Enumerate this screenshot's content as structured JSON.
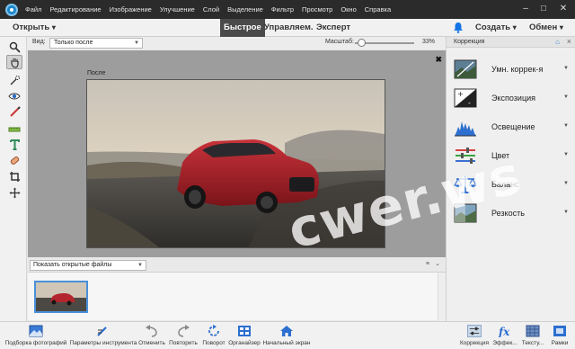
{
  "menubar": {
    "items": [
      "Файл",
      "Редактирование",
      "Изображение",
      "Улучшение",
      "Слой",
      "Выделение",
      "Фильтр",
      "Просмотр",
      "Окно",
      "Справка"
    ],
    "minimize": "–",
    "restore": "□",
    "close": "✕"
  },
  "modebar": {
    "open_label": "Открыть",
    "tabs": [
      "Быстрое",
      "Управляем.",
      "Эксперт"
    ],
    "active_tab": "Быстрое",
    "create_label": "Создать",
    "share_label": "Обмен",
    "chevron": "▾"
  },
  "options": {
    "view_label": "Вид:",
    "view_value": "Только после",
    "zoom_label": "Масштаб:",
    "zoom_value": "33%",
    "zoom_fraction": 0.06
  },
  "canvas": {
    "after_label": "После",
    "close_label": "✖"
  },
  "photo_bin": {
    "select_value": "Показать открытые файлы",
    "menu_icon": "≡",
    "collapse_icon": "⌄"
  },
  "right_panel": {
    "title": "Коррекция",
    "help_icon": "⌂",
    "close_icon": "×",
    "adjustments": [
      {
        "label": "Умн. коррек-я",
        "icon": "smart-fix-icon"
      },
      {
        "label": "Экспозиция",
        "icon": "exposure-icon"
      },
      {
        "label": "Освещение",
        "icon": "lighting-icon"
      },
      {
        "label": "Цвет",
        "icon": "color-icon"
      },
      {
        "label": "Баланс",
        "icon": "balance-icon"
      },
      {
        "label": "Резкость",
        "icon": "sharpen-icon"
      }
    ],
    "chevron": "▼"
  },
  "bottombar": {
    "buttons": [
      {
        "label": "Подборка фотографий",
        "icon": "photo-bin-icon"
      },
      {
        "label": "Параметры инструмента",
        "icon": "tool-options-icon"
      },
      {
        "label": "Отменить",
        "icon": "undo-icon"
      },
      {
        "label": "Повторить",
        "icon": "redo-icon"
      },
      {
        "label": "Поворот",
        "icon": "rotate-icon"
      },
      {
        "label": "Органайзер",
        "icon": "organizer-icon"
      },
      {
        "label": "Начальный экран",
        "icon": "home-icon"
      },
      {
        "label": "Коррекция",
        "icon": "adjustments-icon"
      },
      {
        "label": "Эффек...",
        "icon": "effects-icon"
      },
      {
        "label": "Тексту...",
        "icon": "textures-icon"
      },
      {
        "label": "Рамки",
        "icon": "frames-icon"
      }
    ]
  },
  "watermark": "cwer.ws",
  "colors": {
    "menubar_bg": "#2b2b2b",
    "active_tab_bg": "#4a4a4a",
    "accent_blue": "#1d86c8",
    "canvas_bg": "#9d9d9d"
  }
}
